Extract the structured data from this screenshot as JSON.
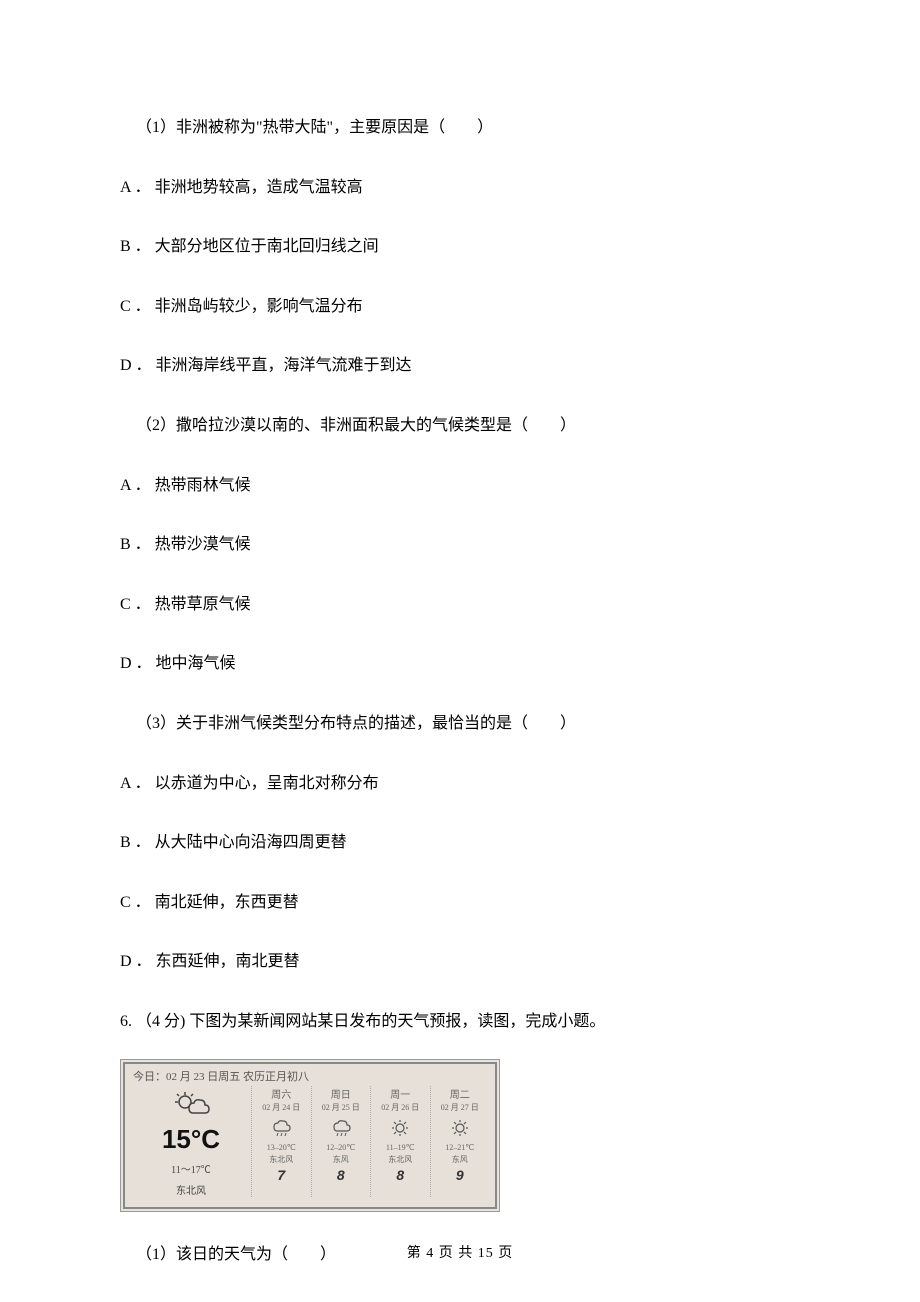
{
  "q1": {
    "stem": "（1）非洲被称为\"热带大陆\"，主要原因是（　　）",
    "A": "A ．  非洲地势较高，造成气温较高",
    "B": "B ．  大部分地区位于南北回归线之间",
    "C": "C ．  非洲岛屿较少，影响气温分布",
    "D": "D ．  非洲海岸线平直，海洋气流难于到达"
  },
  "q2": {
    "stem": "（2）撒哈拉沙漠以南的、非洲面积最大的气候类型是（　　）",
    "A": "A ．  热带雨林气候",
    "B": "B ．  热带沙漠气候",
    "C": "C ．  热带草原气候",
    "D": "D ．  地中海气候"
  },
  "q3": {
    "stem": "（3）关于非洲气候类型分布特点的描述，最恰当的是（　　）",
    "A": "A ．  以赤道为中心，呈南北对称分布",
    "B": "B ．  从大陆中心向沿海四周更替",
    "C": "C ．  南北延伸，东西更替",
    "D": "D ．  东西延伸，南北更替"
  },
  "q6_intro": "6.  （4 分) 下图为某新闻网站某日发布的天气预报，读图，完成小题。",
  "forecast": {
    "header": "今日：02 月 23 日周五 农历正月初八",
    "today": {
      "big_temp": "15°C",
      "range": "11～17℃",
      "wind": "东北风"
    },
    "days": [
      {
        "dow": "周六",
        "date": "02 月 24 日",
        "icon": "rain",
        "temp": "13–20℃",
        "wind": "东北风",
        "level": "7"
      },
      {
        "dow": "周日",
        "date": "02 月 25 日",
        "icon": "rain",
        "temp": "12–20℃",
        "wind": "东风",
        "level": "8"
      },
      {
        "dow": "周一",
        "date": "02 月 26 日",
        "icon": "sun",
        "temp": "11–19℃",
        "wind": "东北风",
        "level": "8"
      },
      {
        "dow": "周二",
        "date": "02 月 27 日",
        "icon": "sun",
        "temp": "12–21℃",
        "wind": "东风",
        "level": "9"
      }
    ]
  },
  "q6_sub1": "（1）该日的天气为（　　）",
  "footer": "第 4 页 共 15 页"
}
